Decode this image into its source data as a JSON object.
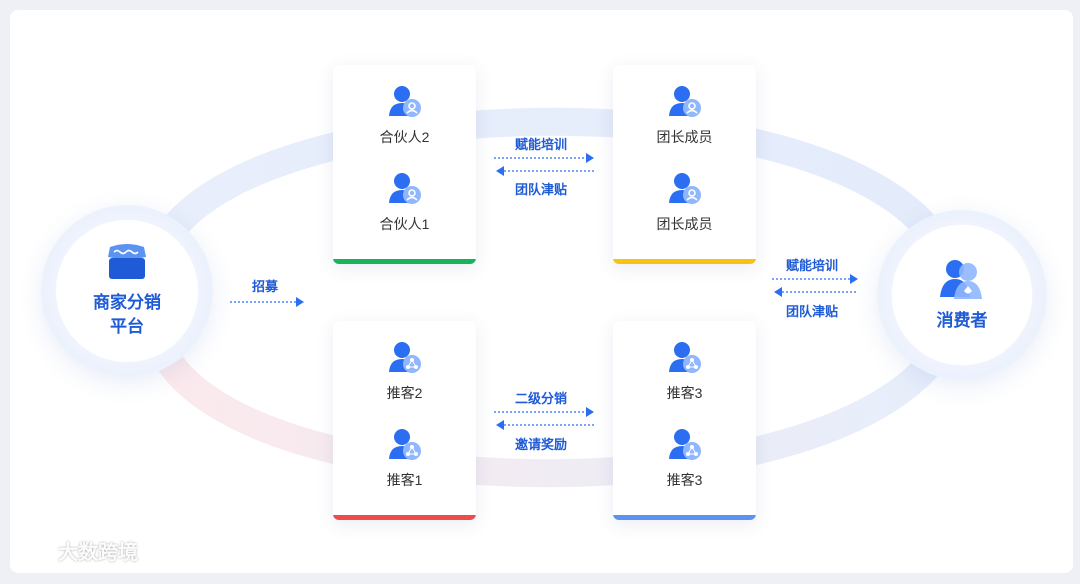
{
  "nodes": {
    "merchant": {
      "label_line1": "商家分销",
      "label_line2": "平台",
      "icon": "shop-icon"
    },
    "consumer": {
      "label": "消费者",
      "icon": "consumer-icon"
    }
  },
  "cards": [
    {
      "id": "partners",
      "members": [
        "合伙人2",
        "合伙人1"
      ],
      "icon": "user-icon",
      "bar_color": "#17b35d"
    },
    {
      "id": "team",
      "members": [
        "团长成员",
        "团长成员"
      ],
      "icon": "user-icon",
      "bar_color": "#f6c213"
    },
    {
      "id": "referrers-left",
      "members": [
        "推客2",
        "推客1"
      ],
      "icon": "share-user-icon",
      "bar_color": "#ee4b4b"
    },
    {
      "id": "referrers-right",
      "members": [
        "推客3",
        "推客3"
      ],
      "icon": "share-user-icon",
      "bar_color": "#5b93f0"
    }
  ],
  "flows": {
    "recruit": "招募",
    "top_forward": "赋能培训",
    "top_back": "团队津贴",
    "right_forward": "赋能培训",
    "right_back": "团队津贴",
    "bottom_forward": "二级分销",
    "bottom_back": "邀请奖励"
  },
  "watermark": "大数跨境",
  "colors": {
    "accent": "#1f5bd6",
    "icon_blue": "#2b6ef2",
    "icon_light": "#8fb6ff"
  }
}
